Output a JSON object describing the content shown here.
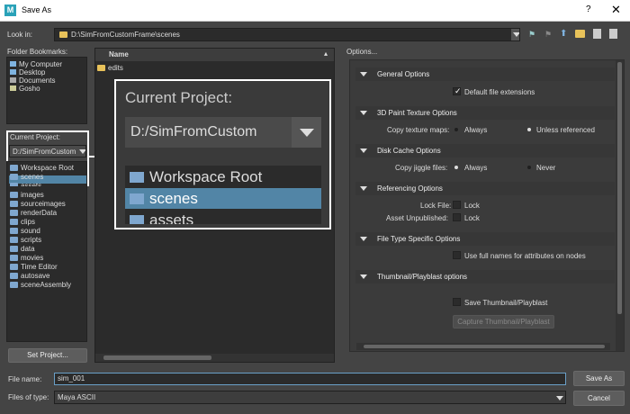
{
  "window": {
    "title": "Save As",
    "help": "?",
    "close": "✕",
    "app_icon_letter": "M"
  },
  "look_in": {
    "label": "Look in:",
    "path": "D:\\SimFromCustomFrame\\scenes"
  },
  "bookmarks": {
    "label": "Folder Bookmarks:",
    "items": [
      "My Computer",
      "Desktop",
      "Documents",
      "Gosho"
    ]
  },
  "current_project": {
    "label": "Current Project:",
    "value": "D:/SimFromCustom",
    "items": [
      "Workspace Root",
      "scenes",
      "assets",
      "images",
      "sourceimages",
      "renderData",
      "clips",
      "sound",
      "scripts",
      "data",
      "movies",
      "Time Editor",
      "autosave",
      "sceneAssembly"
    ],
    "selected": "scenes"
  },
  "set_project_label": "Set Project...",
  "file_list": {
    "header": "Name",
    "items": [
      "edits"
    ]
  },
  "zoom": {
    "label": "Current Project:",
    "value": "D:/SimFromCustom",
    "items": [
      "Workspace Root",
      "scenes",
      "assets"
    ]
  },
  "options": {
    "label": "Options...",
    "general": {
      "title": "General Options",
      "default_ext": "Default file extensions"
    },
    "paint": {
      "title": "3D Paint Texture Options",
      "label": "Copy texture maps:",
      "opt1": "Always",
      "opt2": "Unless referenced"
    },
    "cache": {
      "title": "Disk Cache Options",
      "label": "Copy jiggle files:",
      "opt1": "Always",
      "opt2": "Never"
    },
    "referencing": {
      "title": "Referencing Options",
      "lock_file": "Lock File:",
      "lock1": "Lock",
      "asset_unpub": "Asset Unpublished:",
      "lock2": "Lock"
    },
    "filetype": {
      "title": "File Type Specific Options",
      "full_names": "Use full names for attributes on nodes"
    },
    "thumbnail": {
      "title": "Thumbnail/Playblast options",
      "save": "Save Thumbnail/Playblast",
      "capture": "Capture Thumbnail/Playblast"
    }
  },
  "file_name": {
    "label": "File name:",
    "value": "sim_001",
    "save_label": "Save As"
  },
  "file_type": {
    "label": "Files of type:",
    "value": "Maya ASCII",
    "cancel_label": "Cancel"
  }
}
